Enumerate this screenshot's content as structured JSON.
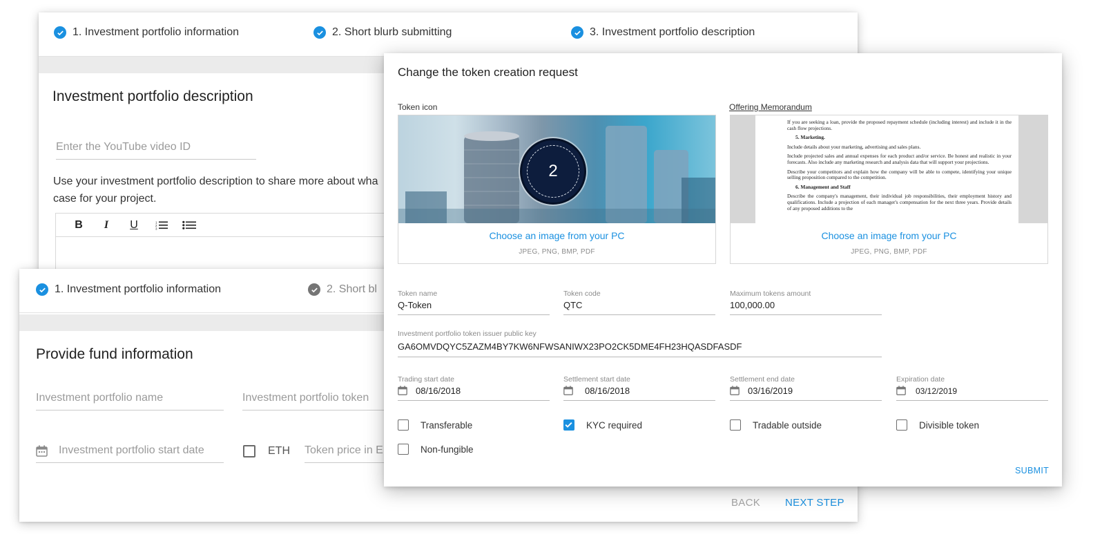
{
  "back_card": {
    "steps": [
      "1. Investment portfolio information",
      "2. Short blurb submitting",
      "3. Investment portfolio description"
    ],
    "title": "Investment portfolio description",
    "youtube_placeholder": "Enter the YouTube video ID",
    "description_line1": "Use your investment portfolio description to share more about wha",
    "description_line2": "case for your project.",
    "toolbar": {
      "bold": "B",
      "italic": "I",
      "underline": "U"
    }
  },
  "left_card": {
    "steps": [
      "1. Investment portfolio information",
      "2. Short bl"
    ],
    "title": "Provide fund information",
    "portfolio_name_placeholder": "Investment portfolio name",
    "portfolio_token_placeholder": "Investment portfolio token",
    "start_date_placeholder": "Investment portfolio start date",
    "eth_label": "ETH",
    "token_price_placeholder": "Token price in E",
    "back_label": "BACK",
    "next_label": "NEXT STEP"
  },
  "modal": {
    "title": "Change the token creation request",
    "token_icon_label": "Token icon",
    "memorandum_label": "Offering Memorandum",
    "token_badge": "2",
    "choose_image": "Choose an image from your PC",
    "file_types": "JPEG, PNG, BMP, PDF",
    "doc": {
      "p1": "If you are seeking a loan, provide the proposed repayment schedule (including interest) and include it in the cash flow projections.",
      "h1": "5.   Marketing.",
      "p2": "Include details about your marketing, advertising and sales plans.",
      "p3": "Include projected sales and annual expenses for each product and/or service. Be honest and realistic in your forecasts. Also include any marketing research and analysis data that will support your projections.",
      "p4": "Describe your competitors and explain how the company will be able to compete, identifying your unique selling proposition compared to the competition.",
      "h2": "6.   Management and Staff",
      "p5": "Describe the company's management, their individual job responsibilities, their employment history and qualifications. Include a projection of each manager's compensation for the next three years. Provide details of any proposed additions to the"
    },
    "fields": {
      "token_name": {
        "label": "Token name",
        "value": "Q-Token"
      },
      "token_code": {
        "label": "Token code",
        "value": "QTC"
      },
      "max_tokens": {
        "label": "Maximum tokens amount",
        "value": "100,000.00"
      },
      "public_key": {
        "label": "Investment portfolio token issuer public key",
        "value": "GA6OMVDQYC5ZAZM4BY7KW6NFWSANIWX23PO2CK5DME4FH23HQASDFASDF"
      },
      "trading_start": {
        "label": "Trading start date",
        "value": "08/16/2018"
      },
      "settlement_start": {
        "label": "Settlement start date",
        "value": "08/16/2018"
      },
      "settlement_end": {
        "label": "Settlement end date",
        "value": "03/16/2019"
      },
      "expiration": {
        "label": "Expiration date",
        "value": "03/12/2019"
      }
    },
    "checkboxes": {
      "transferable": {
        "label": "Transferable",
        "checked": false
      },
      "kyc": {
        "label": "KYC required",
        "checked": true
      },
      "tradable_outside": {
        "label": "Tradable outside",
        "checked": false
      },
      "divisible": {
        "label": "Divisible token",
        "checked": false
      },
      "non_fungible": {
        "label": "Non-fungible",
        "checked": false
      }
    },
    "submit_label": "SUBMIT"
  },
  "colors": {
    "accent": "#1a90e0",
    "muted_text": "#9a9a9a",
    "band": "#ebebeb"
  },
  "icons": [
    "check-circle-icon",
    "bold-icon",
    "italic-icon",
    "underline-icon",
    "ordered-list-icon",
    "bullet-list-icon",
    "calendar-icon",
    "checkbox-checked-icon"
  ]
}
